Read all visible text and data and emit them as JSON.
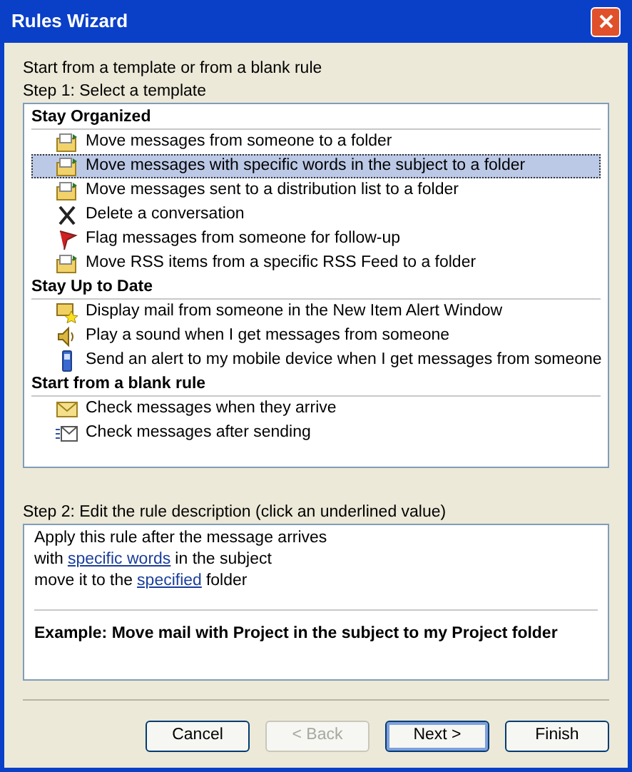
{
  "window": {
    "title": "Rules Wizard"
  },
  "intro": "Start from a template or from a blank rule",
  "step1_label": "Step 1: Select a template",
  "groups": [
    {
      "heading": "Stay Organized",
      "items": [
        {
          "label": "Move messages from someone to a folder",
          "kind": "folder",
          "selected": false
        },
        {
          "label": "Move messages with specific words in the subject to a folder",
          "kind": "folder",
          "selected": true
        },
        {
          "label": "Move messages sent to a distribution list to a folder",
          "kind": "folder",
          "selected": false
        },
        {
          "label": "Delete a conversation",
          "kind": "delete",
          "selected": false
        },
        {
          "label": "Flag messages from someone for follow-up",
          "kind": "flag",
          "selected": false
        },
        {
          "label": "Move RSS items from a specific RSS Feed to a folder",
          "kind": "folder",
          "selected": false
        }
      ]
    },
    {
      "heading": "Stay Up to Date",
      "items": [
        {
          "label": "Display mail from someone in the New Item Alert Window",
          "kind": "alert",
          "selected": false
        },
        {
          "label": "Play a sound when I get messages from someone",
          "kind": "sound",
          "selected": false
        },
        {
          "label": "Send an alert to my mobile device when I get messages from someone",
          "kind": "mobile",
          "selected": false
        }
      ]
    },
    {
      "heading": "Start from a blank rule",
      "items": [
        {
          "label": "Check messages when they arrive",
          "kind": "envelope",
          "selected": false
        },
        {
          "label": "Check messages after sending",
          "kind": "sent",
          "selected": false
        }
      ]
    }
  ],
  "step2_label": "Step 2: Edit the rule description (click an underlined value)",
  "description": [
    [
      {
        "text": "Apply this rule after the message arrives",
        "link": false
      }
    ],
    [
      {
        "text": "with",
        "link": false
      },
      {
        "text": "specific words",
        "link": true
      },
      {
        "text": "in the subject",
        "link": false
      }
    ],
    [
      {
        "text": "move it to the",
        "link": false
      },
      {
        "text": "specified",
        "link": true
      },
      {
        "text": "folder",
        "link": false
      }
    ]
  ],
  "example": "Example: Move mail with Project in the subject to my Project folder",
  "buttons": [
    {
      "label": "Cancel",
      "disabled": false,
      "default": false
    },
    {
      "label": "< Back",
      "disabled": true,
      "default": false
    },
    {
      "label": "Next >",
      "disabled": false,
      "default": true
    },
    {
      "label": "Finish",
      "disabled": false,
      "default": false
    }
  ]
}
